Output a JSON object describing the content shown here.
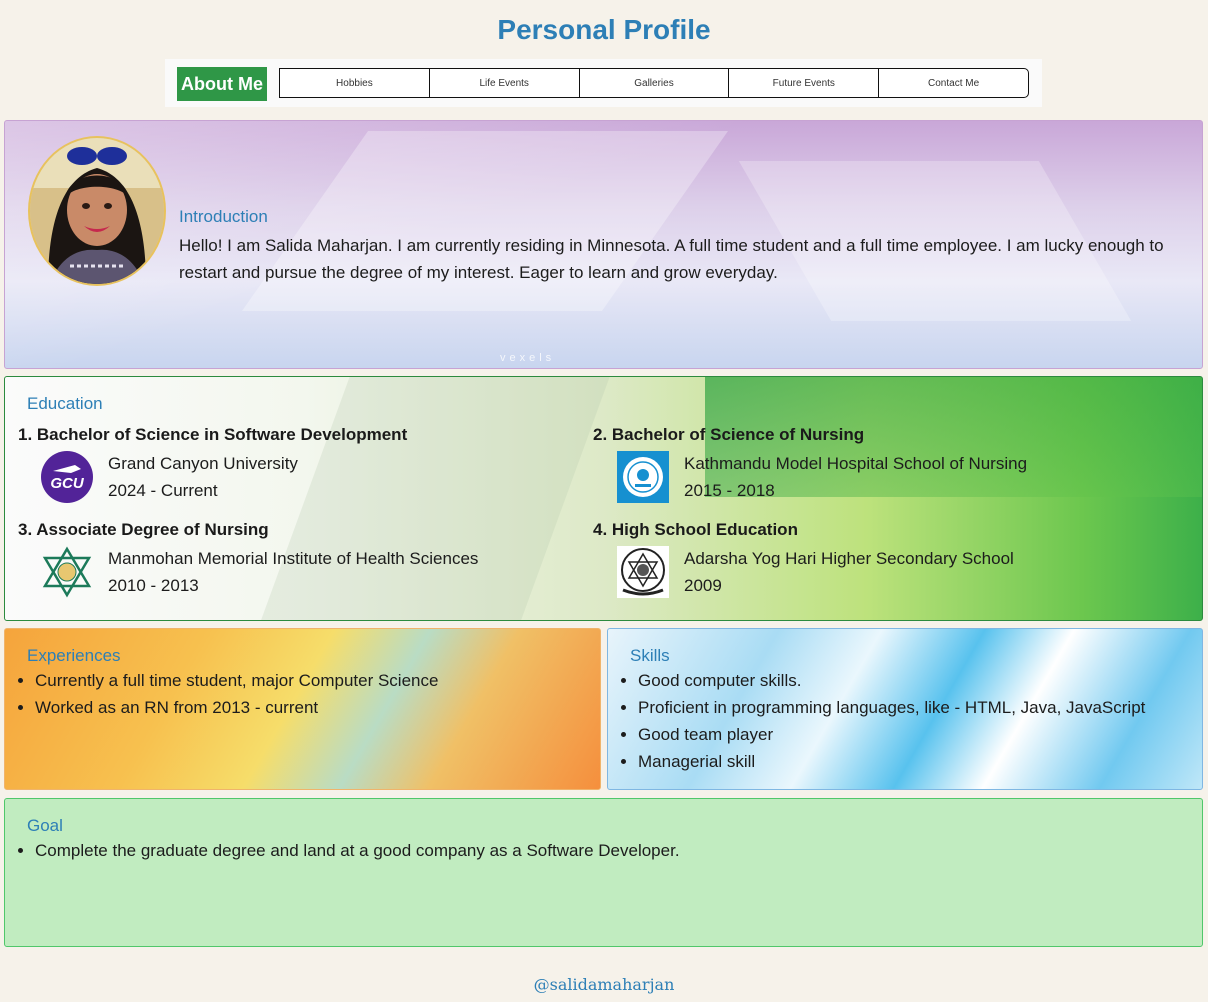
{
  "header": {
    "title": "Personal Profile"
  },
  "nav": {
    "active": "About Me",
    "tabs": [
      "Hobbies",
      "Life Events",
      "Galleries",
      "Future Events",
      "Contact Me"
    ]
  },
  "intro": {
    "heading": "Introduction",
    "text": "Hello! I am Salida Maharjan. I am currently residing in Minnesota. A full time student and a full time employee. I am lucky enough to restart and pursue the degree of my interest. Eager to learn and grow everyday.",
    "watermark": "vexels"
  },
  "education": {
    "heading": "Education",
    "items": [
      {
        "degree": "1. Bachelor of Science in Software Development",
        "school": "Grand Canyon University",
        "years": "2024 - Current",
        "logo_text": "GCU"
      },
      {
        "degree": "2. Bachelor of Science of Nursing",
        "school": "Kathmandu Model Hospital School of Nursing",
        "years": "2015 - 2018"
      },
      {
        "degree": "3. Associate Degree of Nursing",
        "school": "Manmohan Memorial Institute of Health Sciences",
        "years": "2010 - 2013"
      },
      {
        "degree": "4. High School Education",
        "school": "Adarsha Yog Hari Higher Secondary School",
        "years": "2009"
      }
    ]
  },
  "experiences": {
    "heading": "Experiences",
    "items": [
      "Currently a full time student, major Computer Science",
      "Worked as an RN from 2013 - current"
    ]
  },
  "skills": {
    "heading": "Skills",
    "items": [
      "Good computer skills.",
      "Proficient in programming languages, like - HTML, Java, JavaScript",
      "Good team player",
      "Managerial skill"
    ]
  },
  "goal": {
    "heading": "Goal",
    "items": [
      "Complete the graduate degree and land at a good company as a Software Developer."
    ]
  },
  "footer": {
    "handle": "@salidamaharjan"
  }
}
